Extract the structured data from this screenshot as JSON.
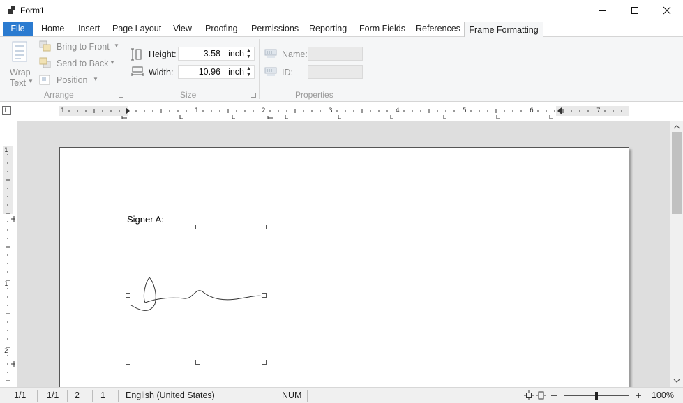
{
  "window": {
    "title": "Form1",
    "icons": {
      "app": "app-icon",
      "minimize": "minimize-icon",
      "maximize": "maximize-icon",
      "close": "close-icon"
    }
  },
  "tabs": [
    {
      "label": "File"
    },
    {
      "label": "Home"
    },
    {
      "label": "Insert"
    },
    {
      "label": "Page Layout"
    },
    {
      "label": "View"
    },
    {
      "label": "Proofing"
    },
    {
      "label": "Permissions"
    },
    {
      "label": "Reporting"
    },
    {
      "label": "Form Fields"
    },
    {
      "label": "References"
    },
    {
      "label": "Frame Formatting",
      "active": true
    }
  ],
  "ribbon": {
    "arrange": {
      "wrap_text_line1": "Wrap",
      "wrap_text_line2": "Text",
      "bring_to_front": "Bring to Front",
      "send_to_back": "Send to Back",
      "position": "Position",
      "group_label": "Arrange"
    },
    "size": {
      "height_label": "Height:",
      "height_value": "3.58",
      "height_unit": "inch",
      "width_label": "Width:",
      "width_value": "10.96",
      "width_unit": "inch",
      "group_label": "Size"
    },
    "properties": {
      "name_label": "Name:",
      "id_label": "ID:",
      "group_label": "Properties"
    }
  },
  "ruler": {
    "corner_label": "L",
    "h_numbers": [
      "1",
      "1",
      "2",
      "3",
      "4",
      "5",
      "6",
      "7"
    ],
    "v_numbers": [
      "1",
      "1",
      "2"
    ]
  },
  "document": {
    "signer_label": "Signer A:"
  },
  "statusbar": {
    "page": "1/1",
    "section": "1/1",
    "line": "2",
    "column": "1",
    "language": "English (United States)",
    "num": "NUM",
    "zoom": "100%",
    "zoom_fraction": 0.5
  }
}
